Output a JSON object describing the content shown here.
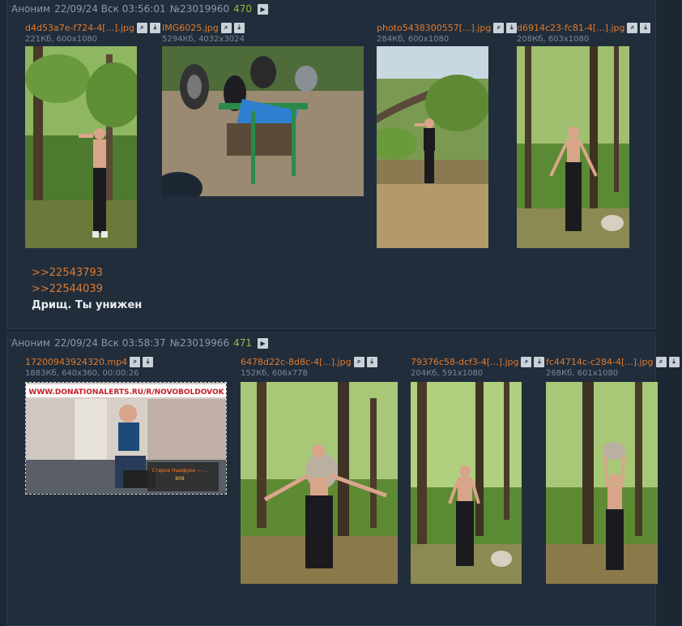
{
  "posts": [
    {
      "author": "Аноним",
      "datetime": "22/09/24 Вск 03:56:01",
      "number": "№23019960",
      "count": "470",
      "files": [
        {
          "name": "d4d53a7e-f724-4[...].jpg",
          "meta": "221Кб, 600x1080"
        },
        {
          "name": "IMG6025.jpg",
          "meta": "5294Кб, 4032x3024"
        },
        {
          "name": "photo5438300557[...].jpg",
          "meta": "284Кб, 600x1080"
        },
        {
          "name": "d6914c23-fc81-4[...].jpg",
          "meta": "208Кб, 603x1080"
        }
      ],
      "links": [
        ">>22543793",
        ">>22544039"
      ],
      "text": "Дрищ. Ты унижен"
    },
    {
      "author": "Аноним",
      "datetime": "22/09/24 Вск 03:58:37",
      "number": "№23019966",
      "count": "471",
      "files": [
        {
          "name": "17200943924320.mp4",
          "meta": "1883Кб, 640x360, 00:00:26"
        },
        {
          "name": "6478d22c-8d8c-4[...].jpg",
          "meta": "152Кб, 606x778"
        },
        {
          "name": "79376c58-dcf3-4[...].jpg",
          "meta": "204Кб, 591x1080"
        },
        {
          "name": "fc44714c-c284-4[...].jpg",
          "meta": "268Кб, 601x1080"
        }
      ],
      "video_overlay": {
        "banner": "WWW.DONATIONALERTS.RU/R/NOVOBOLDOVOK",
        "caption1": "Старое Ныефуке — ...",
        "caption2": "808"
      }
    }
  ],
  "icons": {
    "search": "search-icon",
    "download": "download-icon",
    "play": "play-icon"
  },
  "colors": {
    "link": "#e07a2e",
    "count": "#8fbf3a",
    "background": "#1d2633",
    "post": "#212d3b"
  }
}
